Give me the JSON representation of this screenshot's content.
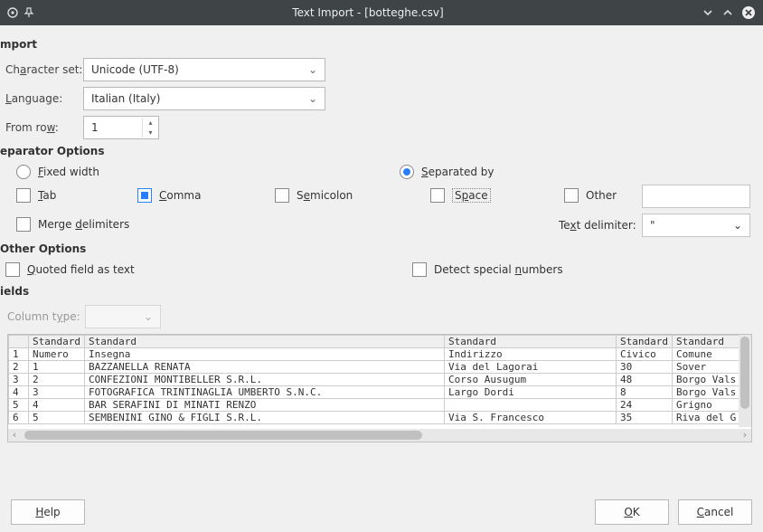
{
  "titlebar": {
    "title": "Text Import - [botteghe.csv]"
  },
  "import": {
    "heading": "mport",
    "charset_label": "Character set:",
    "charset_value": "Unicode (UTF-8)",
    "language_label": "Language:",
    "language_value": "Italian (Italy)",
    "fromrow_label": "From row:",
    "fromrow_value": "1"
  },
  "separator": {
    "heading": "eparator Options",
    "fixed_label": "Fixed width",
    "separated_label": "Separated by",
    "tab_label": "Tab",
    "comma_label": "Comma",
    "semicolon_label": "Semicolon",
    "space_label": "Space",
    "other_label": "Other",
    "merge_label": "Merge delimiters",
    "text_delim_label": "Text delimiter:",
    "text_delim_value": "\""
  },
  "other": {
    "heading": "Other Options",
    "quoted_label": "Quoted field as text",
    "detect_label": "Detect special numbers"
  },
  "fields": {
    "heading": "ields",
    "coltype_label": "Column type:",
    "headers": [
      "Standard",
      "Standard",
      "Standard",
      "Standard",
      "Standard"
    ],
    "rows": [
      [
        "Numero",
        "Insegna",
        "Indirizzo",
        "Civico",
        "Comune"
      ],
      [
        "1",
        "BAZZANELLA RENATA",
        "Via del Lagorai",
        "30",
        "Sover"
      ],
      [
        "2",
        "CONFEZIONI MONTIBELLER S.R.L.",
        "Corso Ausugum",
        "48",
        "Borgo Vals"
      ],
      [
        "3",
        "FOTOGRAFICA TRINTINAGLIA UMBERTO S.N.C.",
        "Largo Dordi",
        "8",
        "Borgo Vals"
      ],
      [
        "4",
        "BAR SERAFINI DI MINATI RENZO",
        "",
        "24",
        "Grigno"
      ],
      [
        "5",
        "SEMBENINI GINO & FIGLI S.R.L.",
        "Via S. Francesco",
        "35",
        "Riva del G"
      ]
    ]
  },
  "footer": {
    "help": "Help",
    "ok": "OK",
    "cancel": "Cancel"
  },
  "colors": {
    "accent": "#2a7fff"
  }
}
